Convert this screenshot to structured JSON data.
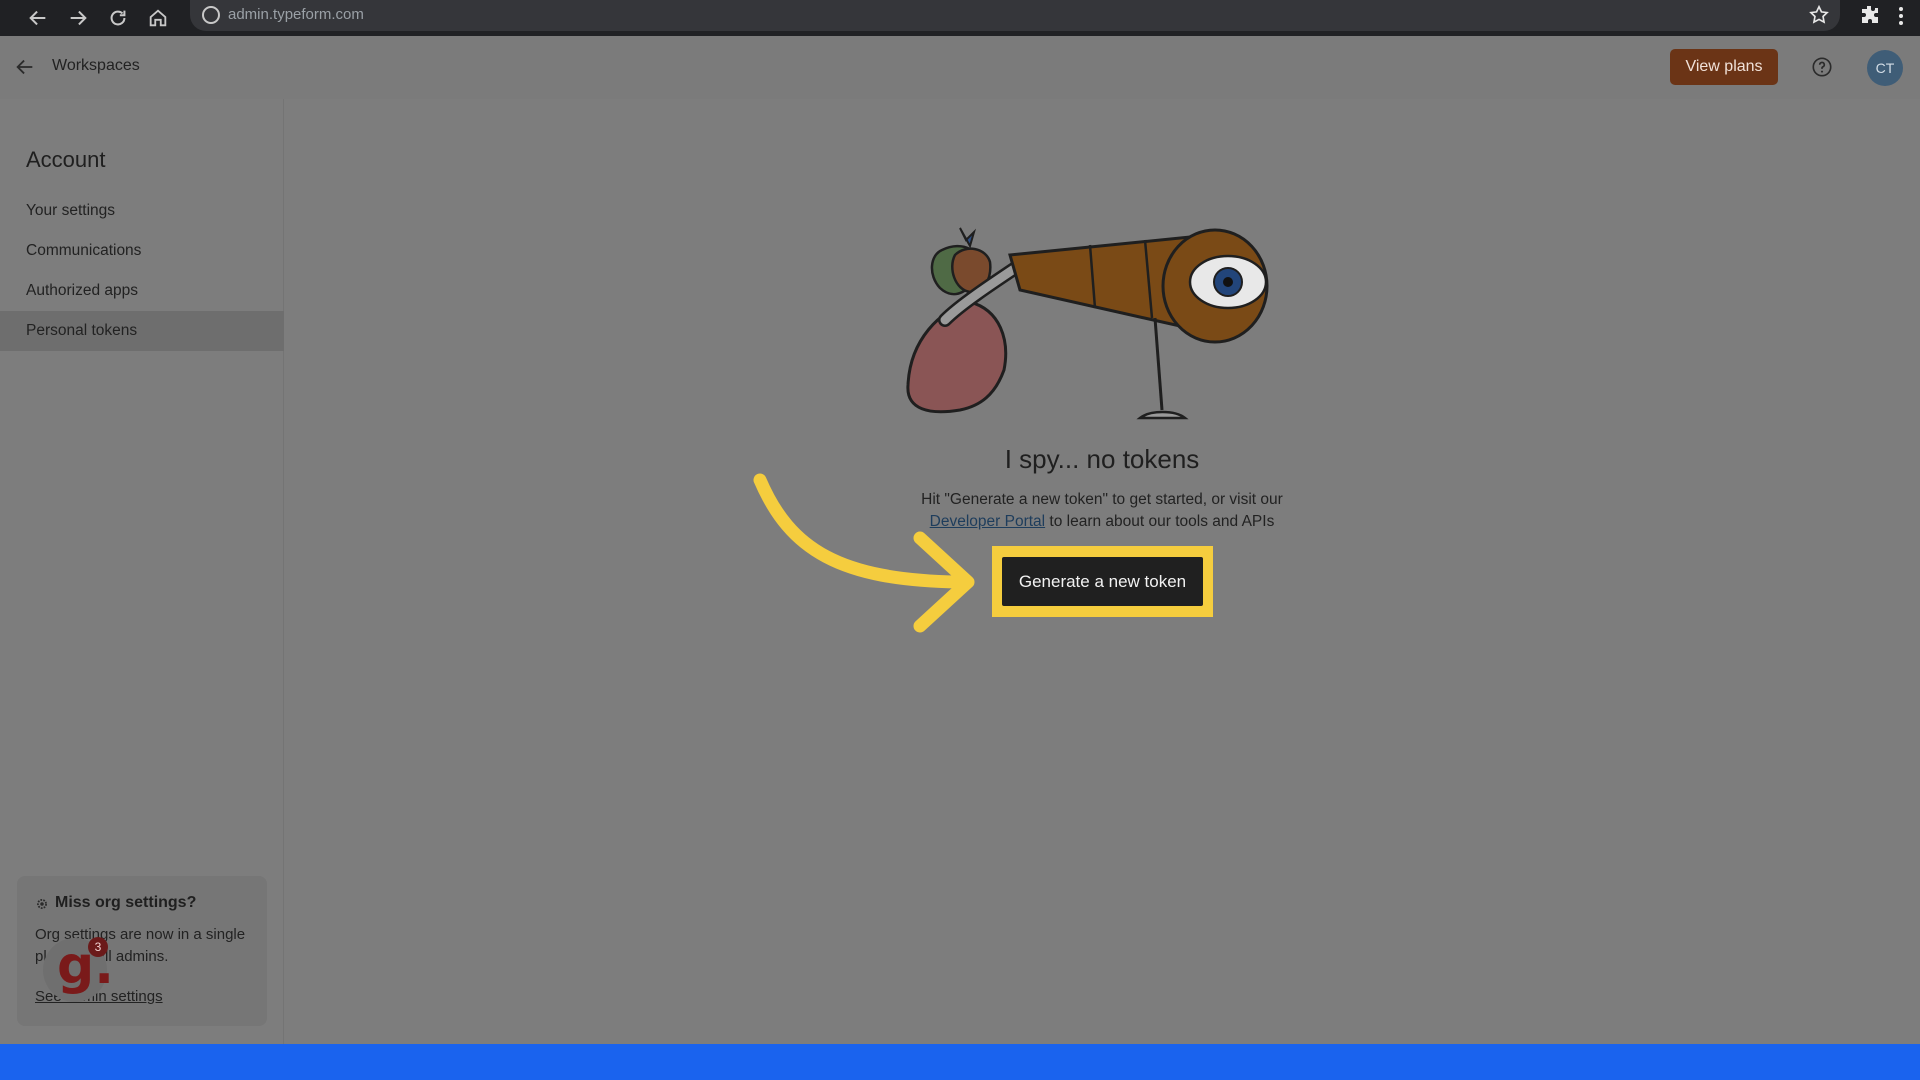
{
  "browser": {
    "url": "admin.typeform.com",
    "icons": [
      "back-icon",
      "forward-icon",
      "reload-icon",
      "home-icon",
      "site-info-icon",
      "star-icon",
      "extensions-icon",
      "kebab-menu-icon"
    ]
  },
  "header": {
    "back_label": "Workspaces",
    "view_plans_label": "View plans",
    "avatar_initials": "CT",
    "colors": {
      "view_plans_bg": "#6b3416",
      "avatar_bg": "#3f5d77"
    }
  },
  "sidebar": {
    "title": "Account",
    "items": [
      {
        "label": "Your settings",
        "active": false
      },
      {
        "label": "Communications",
        "active": false
      },
      {
        "label": "Authorized apps",
        "active": false
      },
      {
        "label": "Personal tokens",
        "active": true
      }
    ],
    "org_card": {
      "title": "Miss org settings?",
      "text": "Org settings are now in a single place for all admins.",
      "link_label": "See admin settings"
    },
    "widget": {
      "letter": "g.",
      "count": "3"
    }
  },
  "main": {
    "empty_title": "I spy... no tokens",
    "desc_before": "Hit \"Generate a new token\" to get started, or visit our",
    "desc_link": "Developer Portal",
    "desc_after": "to learn about our tools and APIs",
    "generate_button_label": "Generate a new token",
    "highlight_color": "#f5cd3e"
  }
}
